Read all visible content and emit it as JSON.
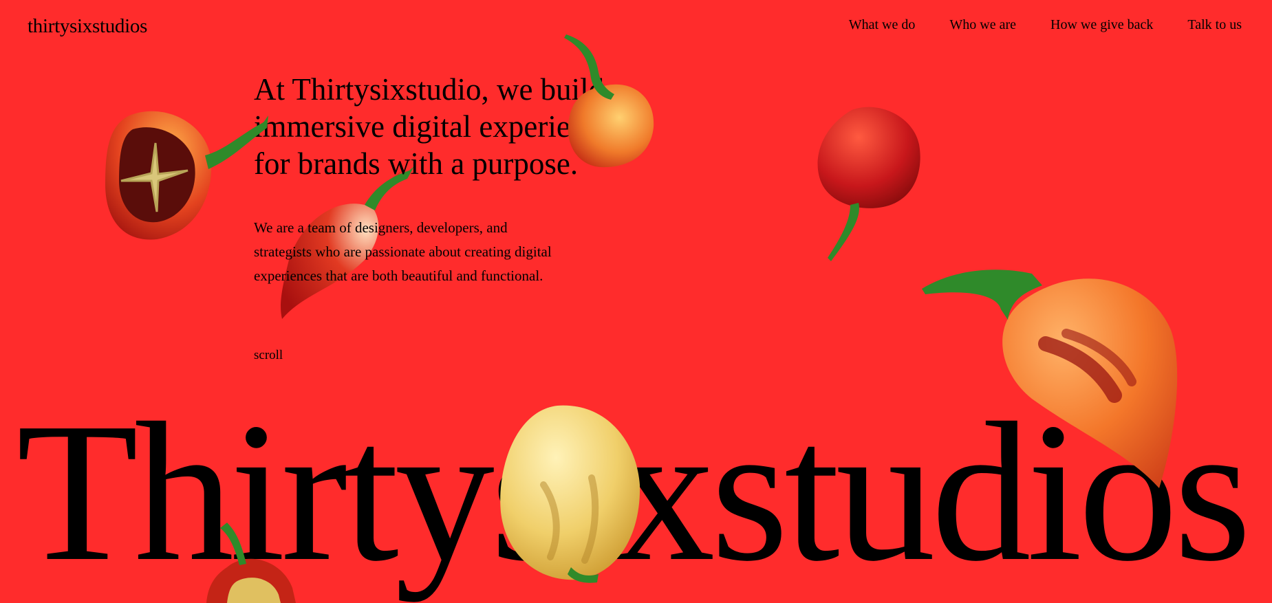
{
  "brand": {
    "logo": "thirtysixstudios",
    "wordmark": "Thirtysixstudios"
  },
  "nav": {
    "items": [
      {
        "label": "What we do"
      },
      {
        "label": "Who we are"
      },
      {
        "label": "How we give back"
      },
      {
        "label": "Talk to us"
      }
    ]
  },
  "hero": {
    "headline": "At Thirtysixstudio, we build immersive digital experiences for brands with a purpose.",
    "body": "We are a team of designers, developers, and strategists who are passionate about creating digital experiences that are both beautiful and functional.",
    "scroll_label": "scroll"
  },
  "colors": {
    "background": "#ff2c2c",
    "text": "#000000",
    "stem": "#2f8a2a",
    "pepper_red": "#c8171b",
    "pepper_orange": "#f4772a",
    "pepper_yellow": "#f0cf6a"
  },
  "decorations": [
    "pepper-icon",
    "pepper-icon",
    "pepper-icon",
    "pepper-icon",
    "pepper-icon",
    "pepper-icon",
    "pepper-icon"
  ]
}
